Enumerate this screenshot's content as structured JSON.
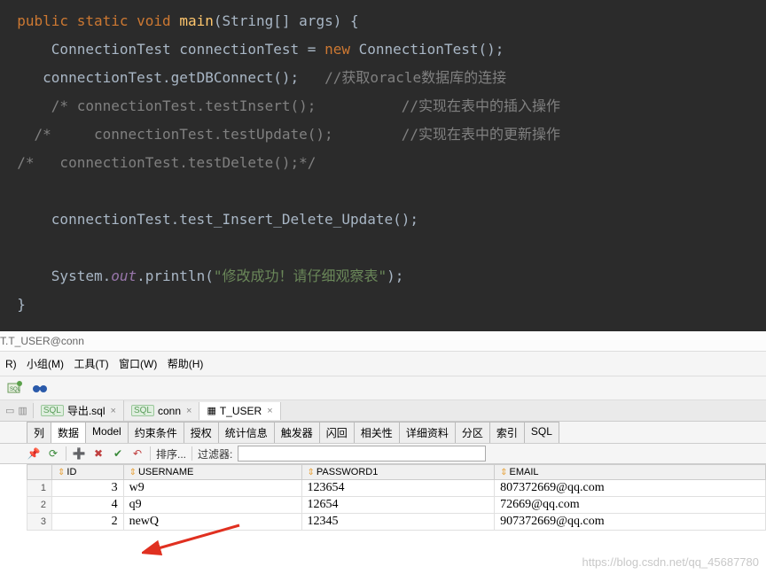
{
  "code": {
    "l1_kw1": "public",
    "l1_kw2": "static",
    "l1_kw3": "void",
    "l1_fn": "main",
    "l1_params": "(String[] args) {",
    "l2_type1": "ConnectionTest",
    "l2_var": "connectionTest",
    "l2_eq": " = ",
    "l2_new": "new",
    "l2_type2": "ConnectionTest",
    "l2_end": "();",
    "l3_text": "connectionTest.getDBConnect();",
    "l3_comment": "//获取oracle数据库的连接",
    "l4_comment": "/* connectionTest.testInsert();          //实现在表中的插入操作",
    "l5_comment": "/*     connectionTest.testUpdate();        //实现在表中的更新操作",
    "l6_comment": "/*   connectionTest.testDelete();*/",
    "l8_text": "connectionTest.test_Insert_Delete_Update();",
    "l10_pre": "System.",
    "l10_out": "out",
    "l10_mid": ".println(",
    "l10_str": "\"修改成功！请仔细观察表\"",
    "l10_end": ");",
    "l11_text": "}"
  },
  "titlebar": "T.T_USER@conn",
  "menu": {
    "items": [
      "R)",
      "小组(M)",
      "工具(T)",
      "窗口(W)",
      "帮助(H)"
    ]
  },
  "tabs": {
    "t1": "导出.sql",
    "t2": "conn",
    "t3": "T_USER"
  },
  "subtabs": [
    "列",
    "数据",
    "Model",
    "约束条件",
    "授权",
    "统计信息",
    "触发器",
    "闪回",
    "相关性",
    "详细资料",
    "分区",
    "索引",
    "SQL"
  ],
  "gridtoolbar": {
    "sort_label": "排序...",
    "filter_label": "过滤器:"
  },
  "grid": {
    "headers": [
      "ID",
      "USERNAME",
      "PASSWORD1",
      "EMAIL"
    ],
    "rows": [
      {
        "n": "1",
        "id": "3",
        "user": "w9",
        "pass": "123654",
        "email": "807372669@qq.com"
      },
      {
        "n": "2",
        "id": "4",
        "user": "q9",
        "pass": "12654",
        "email": "72669@qq.com"
      },
      {
        "n": "3",
        "id": "2",
        "user": "newQ",
        "pass": "12345",
        "email": "907372669@qq.com"
      }
    ]
  },
  "watermark": "https://blog.csdn.net/qq_45687780"
}
